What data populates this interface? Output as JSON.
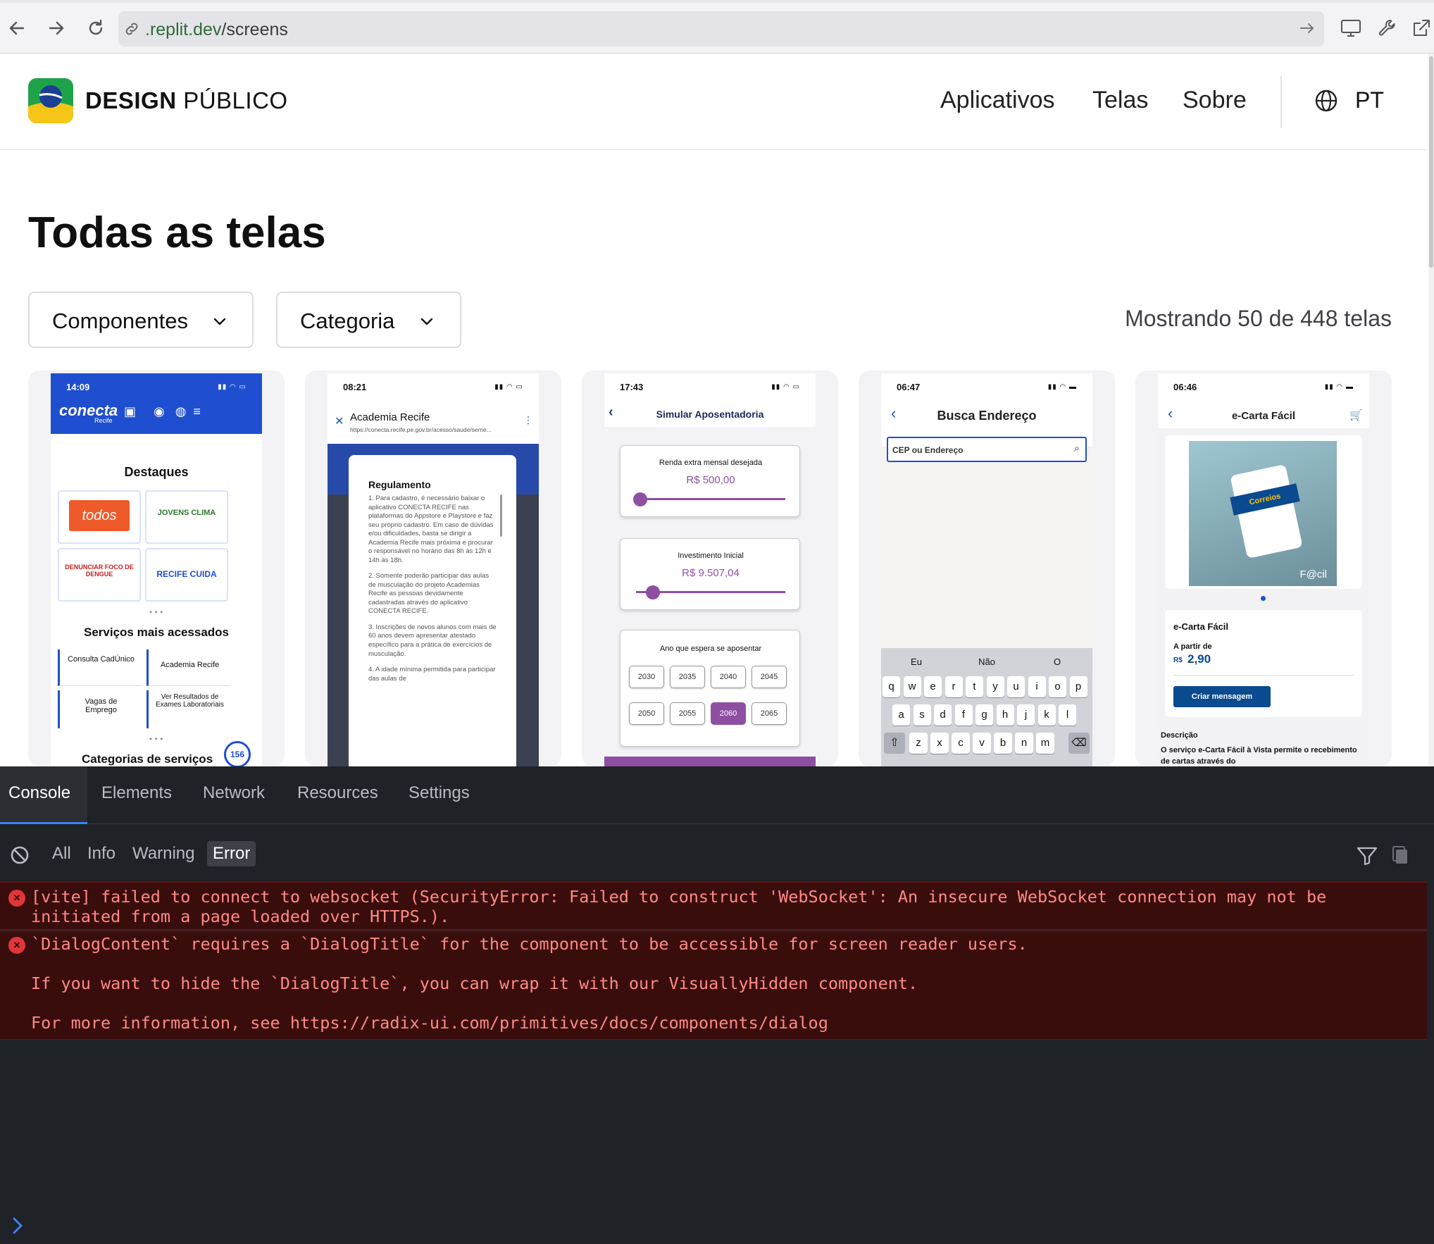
{
  "browser": {
    "url_domain": ".replit.dev",
    "url_path": "/screens"
  },
  "header": {
    "logo_bold": "DESIGN",
    "logo_regular": "PÚBLICO",
    "nav": [
      "Aplicativos",
      "Telas",
      "Sobre"
    ],
    "language": "PT"
  },
  "page": {
    "title": "Todas as telas",
    "filters": [
      "Componentes",
      "Categoria"
    ],
    "count_text": "Mostrando 50 de 448 telas"
  },
  "cards": [
    {
      "time": "14:09",
      "app": "conecta",
      "app_sub": "Recife",
      "section1": "Destaques",
      "tiles": [
        "todos",
        "JOVENS CLIMA",
        "DENUNCIAR FOCO DE DENGUE",
        "RECIFE CUIDA"
      ],
      "section2": "Serviços mais acessados",
      "services": [
        "Consulta CadÚnico",
        "Academia Recife",
        "Vagas de Emprego",
        "Ver Resultados de Exames Laboratoriais"
      ],
      "section3": "Categorias de serviços",
      "badge": "156"
    },
    {
      "time": "08:21",
      "title": "Academia Recife",
      "url": "https://conecta.recife.pe.gov.br/acesso/saude/seme...",
      "dialog_title": "Regulamento",
      "paragraphs": [
        "1. Para cadastro, é necessário baixar o aplicativo CONECTA RECIFE nas plataformas do Appstore e Playstore e faz seu próprio cadastro. Em caso de dúvidas e/ou dificuldades, basta se dirigir a Academia Recife mais próxima e procurar o responsável no horário das 8h às 12h e 14h às 18h.",
        "2. Somente poderão participar das aulas de musculação do projeto Academias Recife as pessoas devidamente cadastradas através do aplicativo CONECTA RECIFE.",
        "3. Inscrições de novos alunos com mais de 60 anos devem apresentar atestado específico para a prática de exercícios de musculação.",
        "4. A idade mínima permitida para participar das aulas de"
      ]
    },
    {
      "time": "17:43",
      "title": "Simular Aposentadoria",
      "field1_label": "Renda extra mensal desejada",
      "field1_value": "R$ 500,00",
      "field2_label": "Investimento Inicial",
      "field2_value": "R$ 9.507,04",
      "field3_label": "Ano que espera se aposentar",
      "years": [
        "2030",
        "2035",
        "2040",
        "2045",
        "2050",
        "2055",
        "2060",
        "2065"
      ],
      "selected_year": "2060",
      "accent": "#8e4fa3"
    },
    {
      "time": "06:47",
      "title": "Busca Endereço",
      "placeholder": "CEP ou Endereço",
      "suggestions": [
        "Eu",
        "Não",
        "O"
      ],
      "row1": [
        "q",
        "w",
        "e",
        "r",
        "t",
        "y",
        "u",
        "i",
        "o",
        "p"
      ],
      "row2": [
        "a",
        "s",
        "d",
        "f",
        "g",
        "h",
        "j",
        "k",
        "l"
      ],
      "row3": [
        "z",
        "x",
        "c",
        "v",
        "b",
        "n",
        "m"
      ]
    },
    {
      "time": "06:46",
      "title": "e-Carta Fácil",
      "product": "e-Carta Fácil",
      "price_label": "A partir de",
      "currency": "R$",
      "price": "2,90",
      "cta": "Criar mensagem",
      "desc_title": "Descrição",
      "desc": "O serviço e-Carta Fácil à Vista permite o recebimento de cartas através do",
      "brand": "Correios",
      "brand_tag": "F@cil"
    }
  ],
  "devtools": {
    "tabs": [
      "Console",
      "Elements",
      "Network",
      "Resources",
      "Settings"
    ],
    "filters": [
      "All",
      "Info",
      "Warning",
      "Error"
    ],
    "active_filter": "Error",
    "logs": [
      "[vite] failed to connect to websocket (SecurityError: Failed to construct 'WebSocket': An insecure WebSocket connection may not be initiated from a page loaded over HTTPS.).",
      "`DialogContent` requires a `DialogTitle` for the component to be accessible for screen reader users.\n\nIf you want to hide the `DialogTitle`, you can wrap it with our VisuallyHidden component.\n\nFor more information, see https://radix-ui.com/primitives/docs/components/dialog"
    ]
  },
  "colors": {
    "conecta_blue": "#1f4fd0",
    "error_bg": "#3a0d0d",
    "error_text": "#ff8a85",
    "devtools_bg": "#1f2226",
    "correios_blue": "#0a4a8f"
  }
}
